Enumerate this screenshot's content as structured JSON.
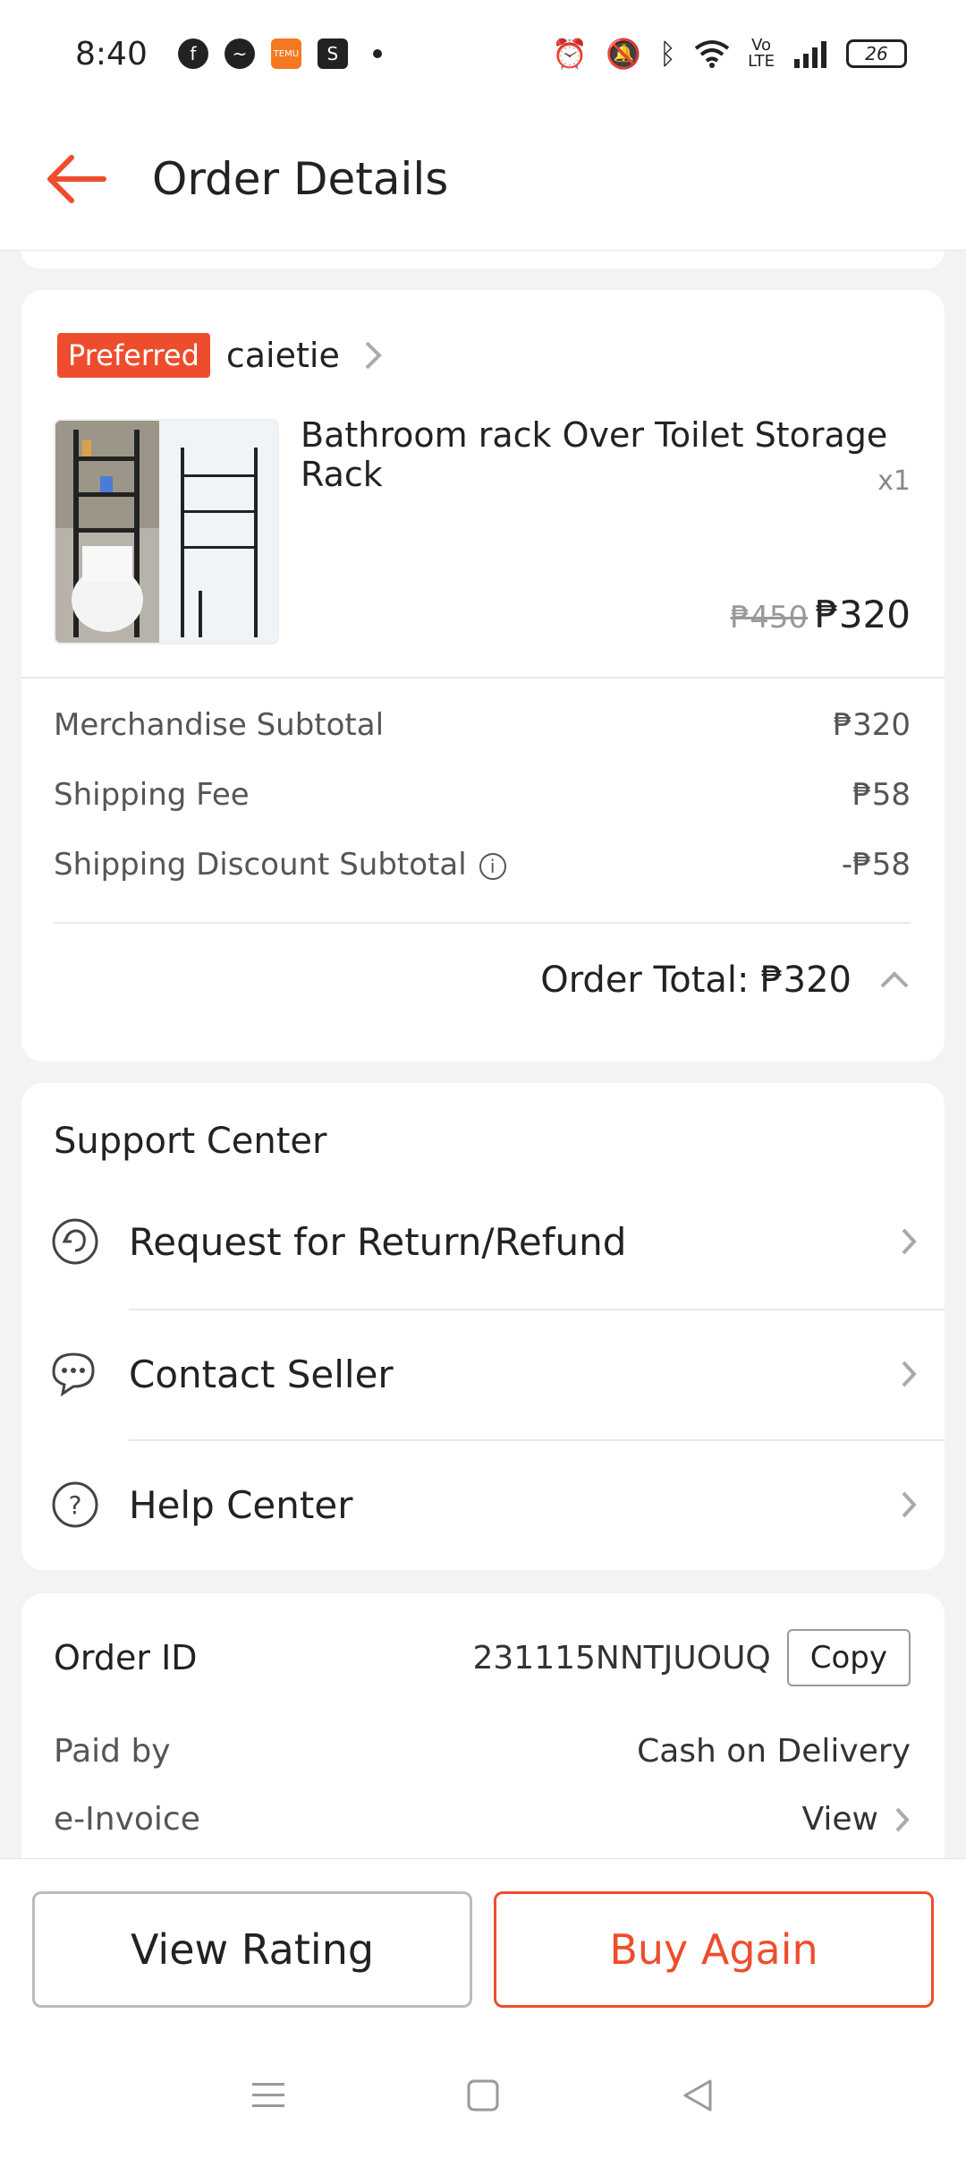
{
  "status_bar": {
    "time": "8:40",
    "battery": "26",
    "icons": [
      "facebook-icon",
      "messenger-icon",
      "temu-icon",
      "shopee-icon",
      "alarm-icon",
      "mute-icon",
      "bluetooth-icon",
      "wifi-icon",
      "volte-icon",
      "signal-icon"
    ],
    "temu_text": "TEMU"
  },
  "header": {
    "title": "Order Details",
    "back_icon": "back-arrow-icon",
    "accent_color": "#ee4d2d"
  },
  "product_card": {
    "badge": "Preferred",
    "shop_name": "caietie",
    "product_title": "Bathroom rack Over Toilet Storage Rack",
    "quantity": "x1",
    "original_price": "₱450",
    "price": "₱320",
    "summary": [
      {
        "label": "Merchandise Subtotal",
        "value": "₱320"
      },
      {
        "label": "Shipping Fee",
        "value": "₱58"
      },
      {
        "label": "Shipping Discount Subtotal",
        "value": "-₱58"
      }
    ],
    "order_total": "Order Total: ₱320"
  },
  "support_center": {
    "title": "Support Center",
    "items": [
      {
        "label": "Request for Return/Refund",
        "icon": "return-icon"
      },
      {
        "label": "Contact Seller",
        "icon": "chat-icon"
      },
      {
        "label": "Help Center",
        "icon": "help-icon"
      }
    ]
  },
  "order_info": {
    "order_id_label": "Order ID",
    "order_id": "231115NNTJUOUQ",
    "copy_label": "Copy",
    "paid_by_label": "Paid by",
    "paid_by": "Cash on Delivery",
    "einvoice_label": "e-Invoice",
    "einvoice_value": "View"
  },
  "actions": {
    "view_rating": "View Rating",
    "buy_again": "Buy Again"
  },
  "nav": {
    "icons": [
      "menu-icon",
      "home-icon",
      "back-icon"
    ]
  }
}
